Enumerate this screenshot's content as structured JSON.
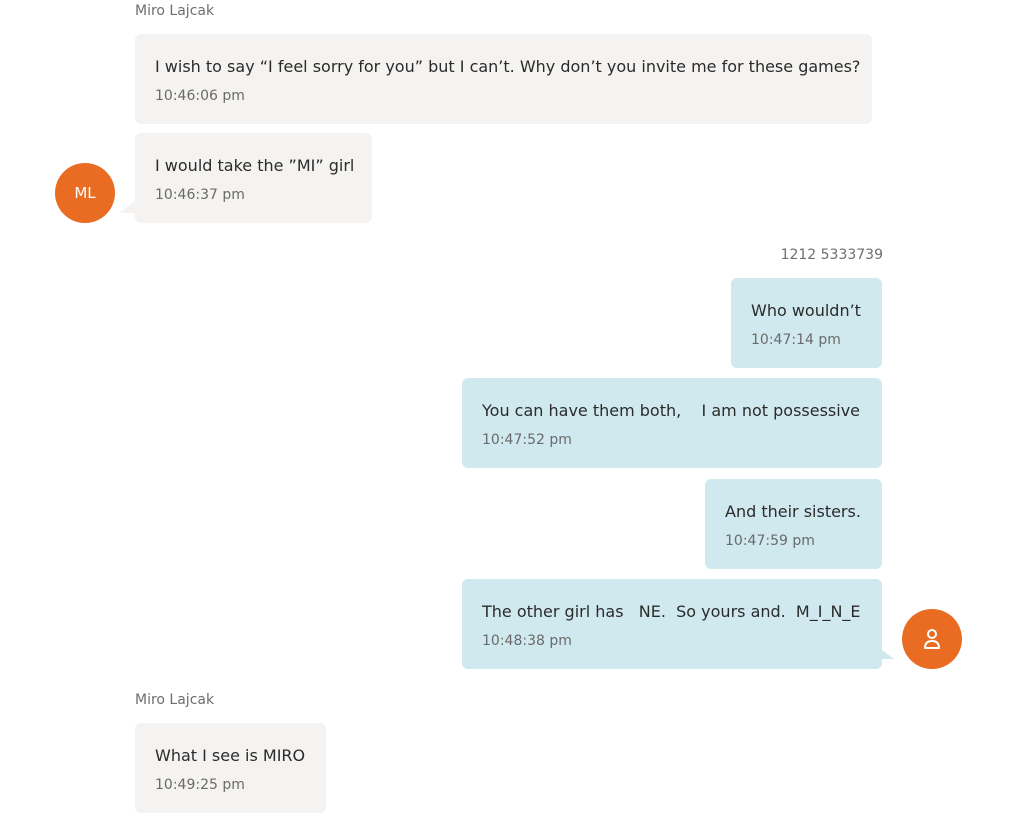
{
  "colors": {
    "incoming_bubble": "#f4f3f1",
    "outgoing_bubble": "#d0e9ef",
    "avatar_orange": "#ea6b22"
  },
  "conversation": {
    "group1": {
      "sender": "Miro Lajcak",
      "avatar_initials": "ML",
      "messages": [
        {
          "text": "I wish to say “I feel sorry for you” but I can’t. Why don’t you invite me for these games?",
          "time": "10:46:06 pm"
        },
        {
          "text": "I would take the ”MI” girl",
          "time": "10:46:37 pm"
        }
      ]
    },
    "group2": {
      "sender": "1212 5333739",
      "avatar_icon": "user-icon",
      "messages": [
        {
          "text": "Who wouldn’t",
          "time": "10:47:14 pm"
        },
        {
          "text": "You can have them both,    I am not possessive",
          "time": "10:47:52 pm"
        },
        {
          "text": "And their sisters.",
          "time": "10:47:59 pm"
        },
        {
          "text": "The other girl has   NE.  So yours and.  M_I_N_E",
          "time": "10:48:38 pm"
        }
      ]
    },
    "group3": {
      "sender": "Miro Lajcak",
      "messages": [
        {
          "text": "What I see is MIRO",
          "time": "10:49:25 pm"
        }
      ]
    }
  }
}
